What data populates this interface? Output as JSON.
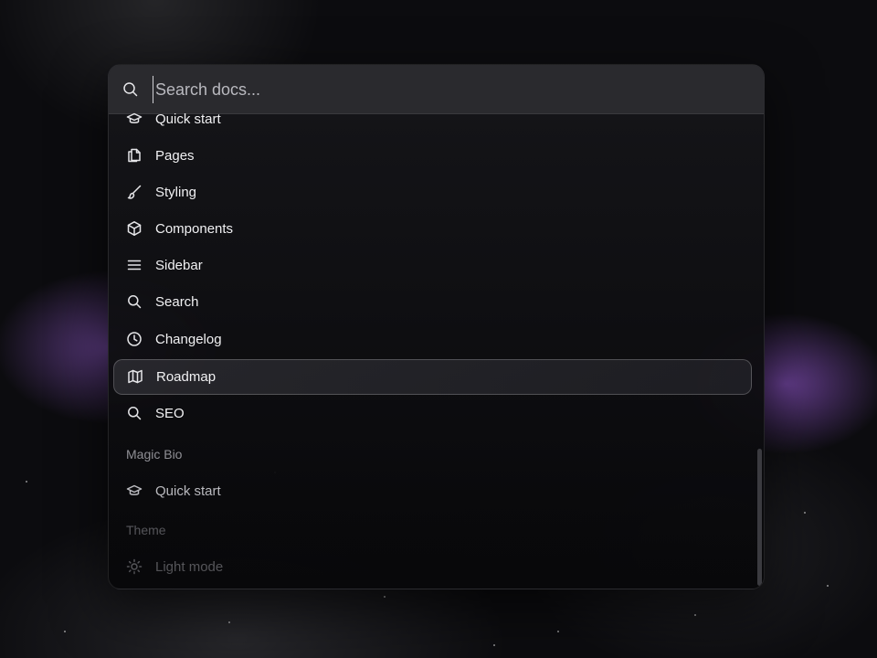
{
  "search": {
    "placeholder": "Search docs..."
  },
  "items": [
    {
      "label": "Quick start",
      "icon": "graduation-cap-icon"
    },
    {
      "label": "Pages",
      "icon": "copy-icon"
    },
    {
      "label": "Styling",
      "icon": "brush-icon"
    },
    {
      "label": "Components",
      "icon": "cube-icon"
    },
    {
      "label": "Sidebar",
      "icon": "menu-icon"
    },
    {
      "label": "Search",
      "icon": "search-icon"
    },
    {
      "label": "Changelog",
      "icon": "clock-icon"
    },
    {
      "label": "Roadmap",
      "icon": "map-icon",
      "active": true
    },
    {
      "label": "SEO",
      "icon": "search-icon"
    }
  ],
  "groups": {
    "magic_bio": {
      "title": "Magic Bio",
      "items": [
        {
          "label": "Quick start",
          "icon": "graduation-cap-icon"
        }
      ]
    },
    "theme": {
      "title": "Theme",
      "items": [
        {
          "label": "Light mode",
          "icon": "sun-icon"
        }
      ]
    }
  },
  "colors": {
    "accent_glow": "#a96ef0",
    "palette_bg": "#0b0b0d",
    "search_bar_bg": "#2a2a2e"
  }
}
